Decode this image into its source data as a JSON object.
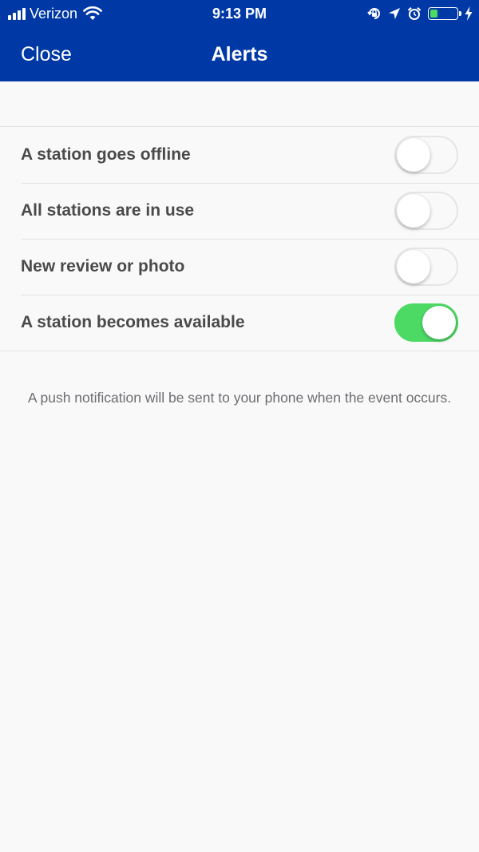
{
  "status_bar": {
    "carrier": "Verizon",
    "time": "9:13 PM",
    "battery_level": 0.3,
    "battery_color": "#4cd964"
  },
  "nav": {
    "close_label": "Close",
    "title": "Alerts",
    "background_color": "#0039a6"
  },
  "alerts": [
    {
      "label": "A station goes offline",
      "enabled": false
    },
    {
      "label": "All stations are in use",
      "enabled": false
    },
    {
      "label": "New review or photo",
      "enabled": false
    },
    {
      "label": "A station becomes available",
      "enabled": true
    }
  ],
  "footer_note": "A push notification will be sent to your phone when the event occurs.",
  "toggle_on_color": "#4cd964",
  "icons": {
    "signal": "cellular-signal-icon",
    "wifi": "wifi-icon",
    "rotation_lock": "rotation-lock-icon",
    "location": "location-arrow-icon",
    "alarm": "alarm-clock-icon",
    "battery": "battery-icon",
    "charging": "charging-bolt-icon"
  }
}
